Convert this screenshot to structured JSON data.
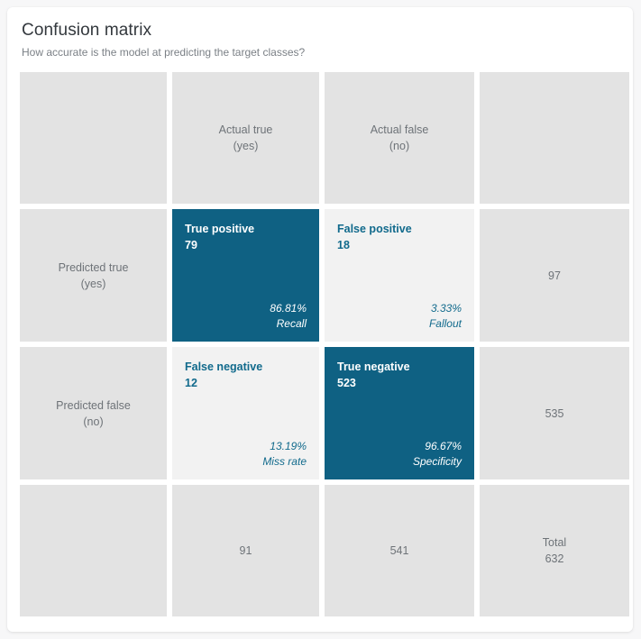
{
  "card": {
    "title": "Confusion matrix",
    "subtitle": "How accurate is the model at predicting the target classes?"
  },
  "colors": {
    "accent_strong": "#0f6183",
    "accent_text": "#116a8c",
    "cell_head_bg": "#e3e3e3",
    "cell_light_bg": "#f2f2f2",
    "card_bg": "#ffffff",
    "page_bg": "#f7f7f8",
    "muted_text": "#6e7378",
    "title_text": "#33383d"
  },
  "matrix": {
    "column_headers": {
      "actual_true": "Actual true\n(yes)",
      "actual_false": "Actual false\n(no)"
    },
    "row_headers": {
      "predicted_true": "Predicted true\n(yes)",
      "predicted_false": "Predicted false\n(no)"
    },
    "quadrants": {
      "true_positive": {
        "label": "True positive",
        "count": "79",
        "percent": "86.81%",
        "metric": "Recall"
      },
      "false_positive": {
        "label": "False positive",
        "count": "18",
        "percent": "3.33%",
        "metric": "Fallout"
      },
      "false_negative": {
        "label": "False negative",
        "count": "12",
        "percent": "13.19%",
        "metric": "Miss rate"
      },
      "true_negative": {
        "label": "True negative",
        "count": "523",
        "percent": "96.67%",
        "metric": "Specificity"
      }
    },
    "row_totals": {
      "predicted_true": "97",
      "predicted_false": "535"
    },
    "column_totals": {
      "actual_true": "91",
      "actual_false": "541"
    },
    "grand_total": {
      "label": "Total",
      "value": "632"
    }
  },
  "chart_data": {
    "type": "table",
    "title": "Confusion matrix",
    "subtitle": "How accurate is the model at predicting the target classes?",
    "categories": [
      "Actual true (yes)",
      "Actual false (no)"
    ],
    "rows": [
      "Predicted true (yes)",
      "Predicted false (no)"
    ],
    "values": [
      [
        79,
        18
      ],
      [
        12,
        523
      ]
    ],
    "cell_labels": [
      [
        "True positive",
        "False positive"
      ],
      [
        "False negative",
        "True negative"
      ]
    ],
    "cell_metrics": [
      [
        {
          "name": "Recall",
          "percent": 86.81
        },
        {
          "name": "Fallout",
          "percent": 3.33
        }
      ],
      [
        {
          "name": "Miss rate",
          "percent": 13.19
        },
        {
          "name": "Specificity",
          "percent": 96.67
        }
      ]
    ],
    "row_totals": [
      97,
      535
    ],
    "column_totals": [
      91,
      541
    ],
    "total": 632,
    "xlabel": "",
    "ylabel": ""
  }
}
